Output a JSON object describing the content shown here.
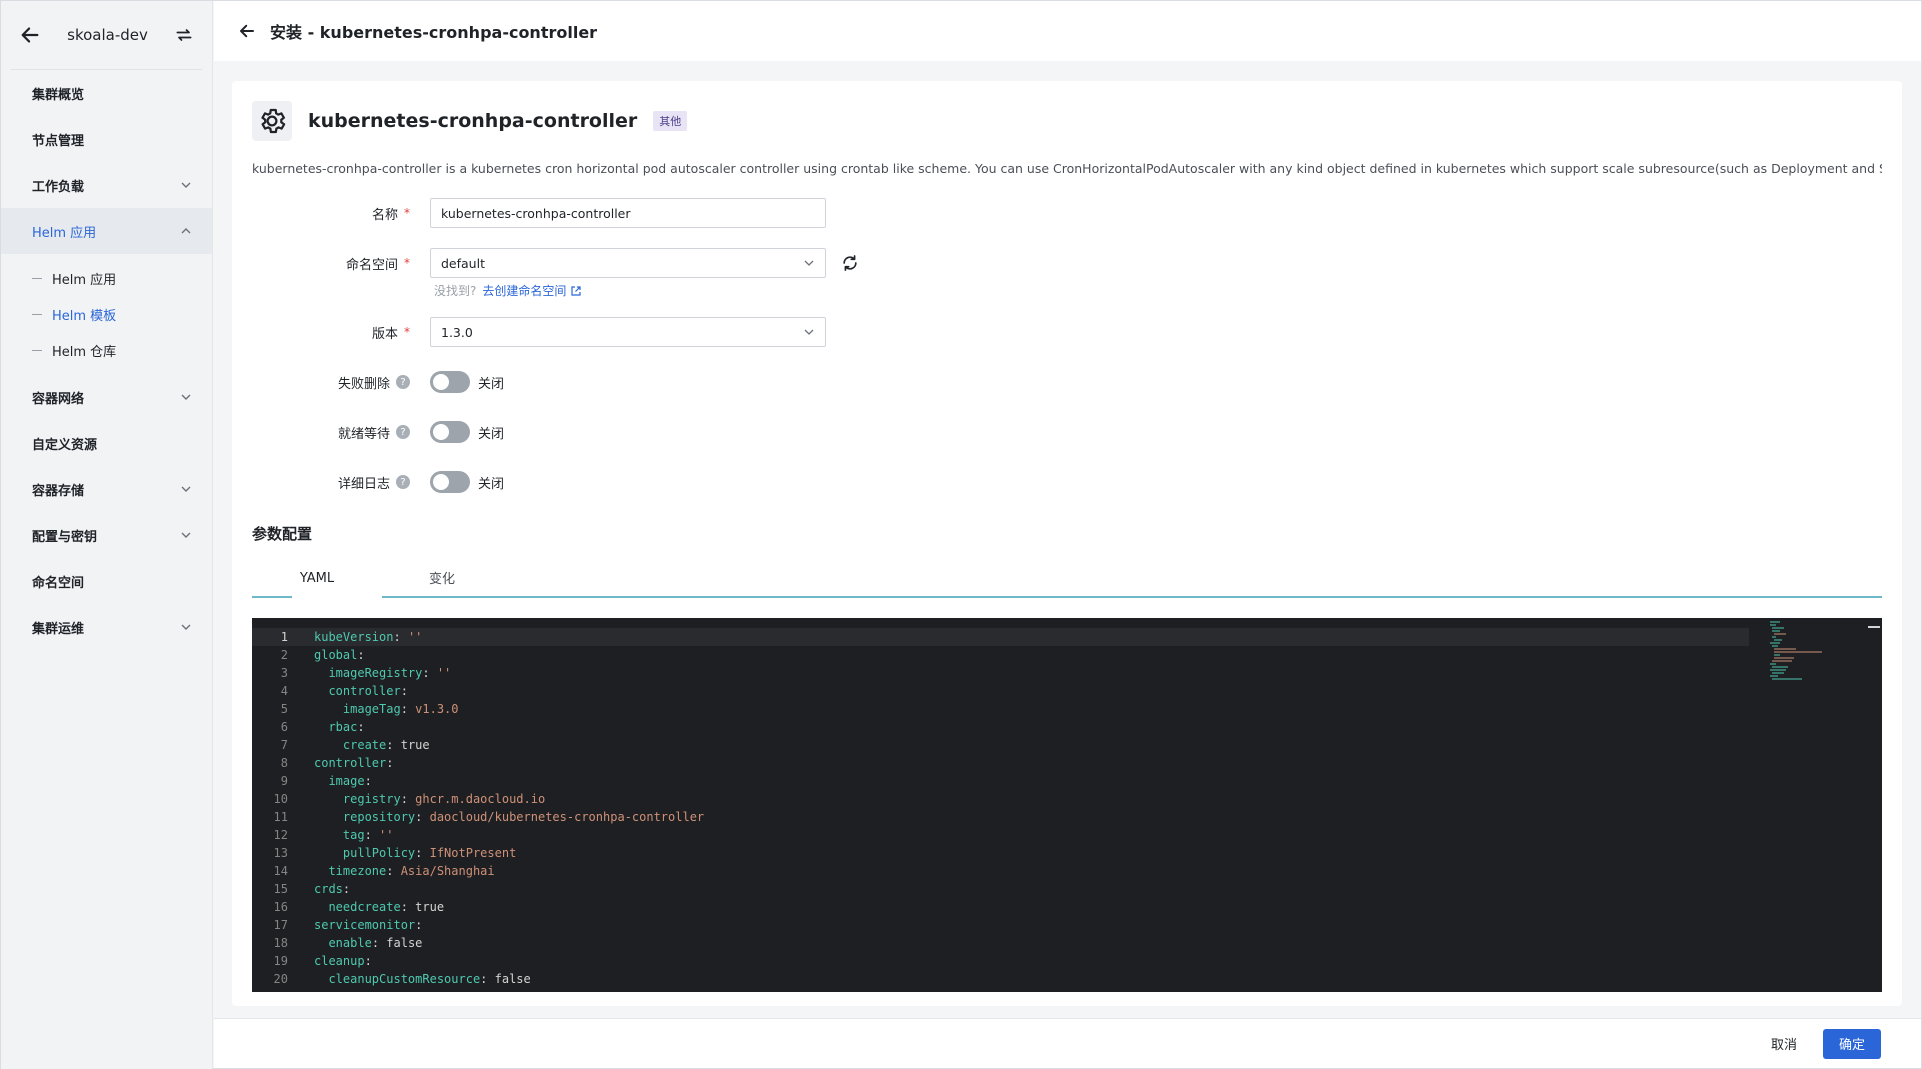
{
  "sidebar": {
    "cluster_name": "skoala-dev",
    "items": [
      {
        "label": "集群概览",
        "has_chevron": false
      },
      {
        "label": "节点管理",
        "has_chevron": false
      },
      {
        "label": "工作负载",
        "has_chevron": true
      },
      {
        "label": "Helm 应用",
        "has_chevron": true,
        "active": true
      },
      {
        "label": "容器网络",
        "has_chevron": true
      },
      {
        "label": "自定义资源",
        "has_chevron": false
      },
      {
        "label": "容器存储",
        "has_chevron": true
      },
      {
        "label": "配置与密钥",
        "has_chevron": true
      },
      {
        "label": "命名空间",
        "has_chevron": false
      },
      {
        "label": "集群运维",
        "has_chevron": true
      }
    ],
    "sub_items": [
      {
        "label": "Helm 应用"
      },
      {
        "label": "Helm 模板",
        "active": true
      },
      {
        "label": "Helm 仓库"
      }
    ]
  },
  "header": {
    "title": "安装 - kubernetes-cronhpa-controller"
  },
  "app": {
    "name": "kubernetes-cronhpa-controller",
    "tag": "其他",
    "description": "kubernetes-cronhpa-controller is a kubernetes cron horizontal pod autoscaler controller using crontab like scheme. You can use CronHorizontalPodAutoscaler with any kind object defined in kubernetes which support scale subresource(such as Deployment and StatefulSet)."
  },
  "form": {
    "name_label": "名称",
    "name_value": "kubernetes-cronhpa-controller",
    "namespace_label": "命名空间",
    "namespace_value": "default",
    "namespace_hint": "没找到?",
    "namespace_link": "去创建命名空间",
    "version_label": "版本",
    "version_value": "1.3.0",
    "fail_delete_label": "失败删除",
    "fail_delete_state": "关闭",
    "ready_wait_label": "就绪等待",
    "ready_wait_state": "关闭",
    "verbose_log_label": "详细日志",
    "verbose_log_state": "关闭"
  },
  "params": {
    "section_title": "参数配置",
    "tab_yaml": "YAML",
    "tab_diff": "变化"
  },
  "yaml_lines": [
    [
      [
        "k",
        "kubeVersion"
      ],
      [
        "c",
        ": "
      ],
      [
        "v",
        "''"
      ]
    ],
    [
      [
        "k",
        "global"
      ],
      [
        "c",
        ":"
      ]
    ],
    [
      [
        "c",
        "  "
      ],
      [
        "k",
        "imageRegistry"
      ],
      [
        "c",
        ": "
      ],
      [
        "v",
        "''"
      ]
    ],
    [
      [
        "c",
        "  "
      ],
      [
        "k",
        "controller"
      ],
      [
        "c",
        ":"
      ]
    ],
    [
      [
        "c",
        "    "
      ],
      [
        "k",
        "imageTag"
      ],
      [
        "c",
        ": "
      ],
      [
        "v",
        "v1.3.0"
      ]
    ],
    [
      [
        "c",
        "  "
      ],
      [
        "k",
        "rbac"
      ],
      [
        "c",
        ":"
      ]
    ],
    [
      [
        "c",
        "    "
      ],
      [
        "k",
        "create"
      ],
      [
        "c",
        ": "
      ],
      [
        "c",
        "true"
      ]
    ],
    [
      [
        "k",
        "controller"
      ],
      [
        "c",
        ":"
      ]
    ],
    [
      [
        "c",
        "  "
      ],
      [
        "k",
        "image"
      ],
      [
        "c",
        ":"
      ]
    ],
    [
      [
        "c",
        "    "
      ],
      [
        "k",
        "registry"
      ],
      [
        "c",
        ": "
      ],
      [
        "v",
        "ghcr.m.daocloud.io"
      ]
    ],
    [
      [
        "c",
        "    "
      ],
      [
        "k",
        "repository"
      ],
      [
        "c",
        ": "
      ],
      [
        "v",
        "daocloud/kubernetes-cronhpa-controller"
      ]
    ],
    [
      [
        "c",
        "    "
      ],
      [
        "k",
        "tag"
      ],
      [
        "c",
        ": "
      ],
      [
        "v",
        "''"
      ]
    ],
    [
      [
        "c",
        "    "
      ],
      [
        "k",
        "pullPolicy"
      ],
      [
        "c",
        ": "
      ],
      [
        "v",
        "IfNotPresent"
      ]
    ],
    [
      [
        "c",
        "  "
      ],
      [
        "k",
        "timezone"
      ],
      [
        "c",
        ": "
      ],
      [
        "v",
        "Asia/Shanghai"
      ]
    ],
    [
      [
        "k",
        "crds"
      ],
      [
        "c",
        ":"
      ]
    ],
    [
      [
        "c",
        "  "
      ],
      [
        "k",
        "needcreate"
      ],
      [
        "c",
        ": "
      ],
      [
        "c",
        "true"
      ]
    ],
    [
      [
        "k",
        "servicemonitor"
      ],
      [
        "c",
        ":"
      ]
    ],
    [
      [
        "c",
        "  "
      ],
      [
        "k",
        "enable"
      ],
      [
        "c",
        ": "
      ],
      [
        "c",
        "false"
      ]
    ],
    [
      [
        "k",
        "cleanup"
      ],
      [
        "c",
        ":"
      ]
    ],
    [
      [
        "c",
        "  "
      ],
      [
        "k",
        "cleanupCustomResource"
      ],
      [
        "c",
        ": "
      ],
      [
        "c",
        "false"
      ]
    ]
  ],
  "footer": {
    "cancel": "取消",
    "confirm": "确定"
  }
}
